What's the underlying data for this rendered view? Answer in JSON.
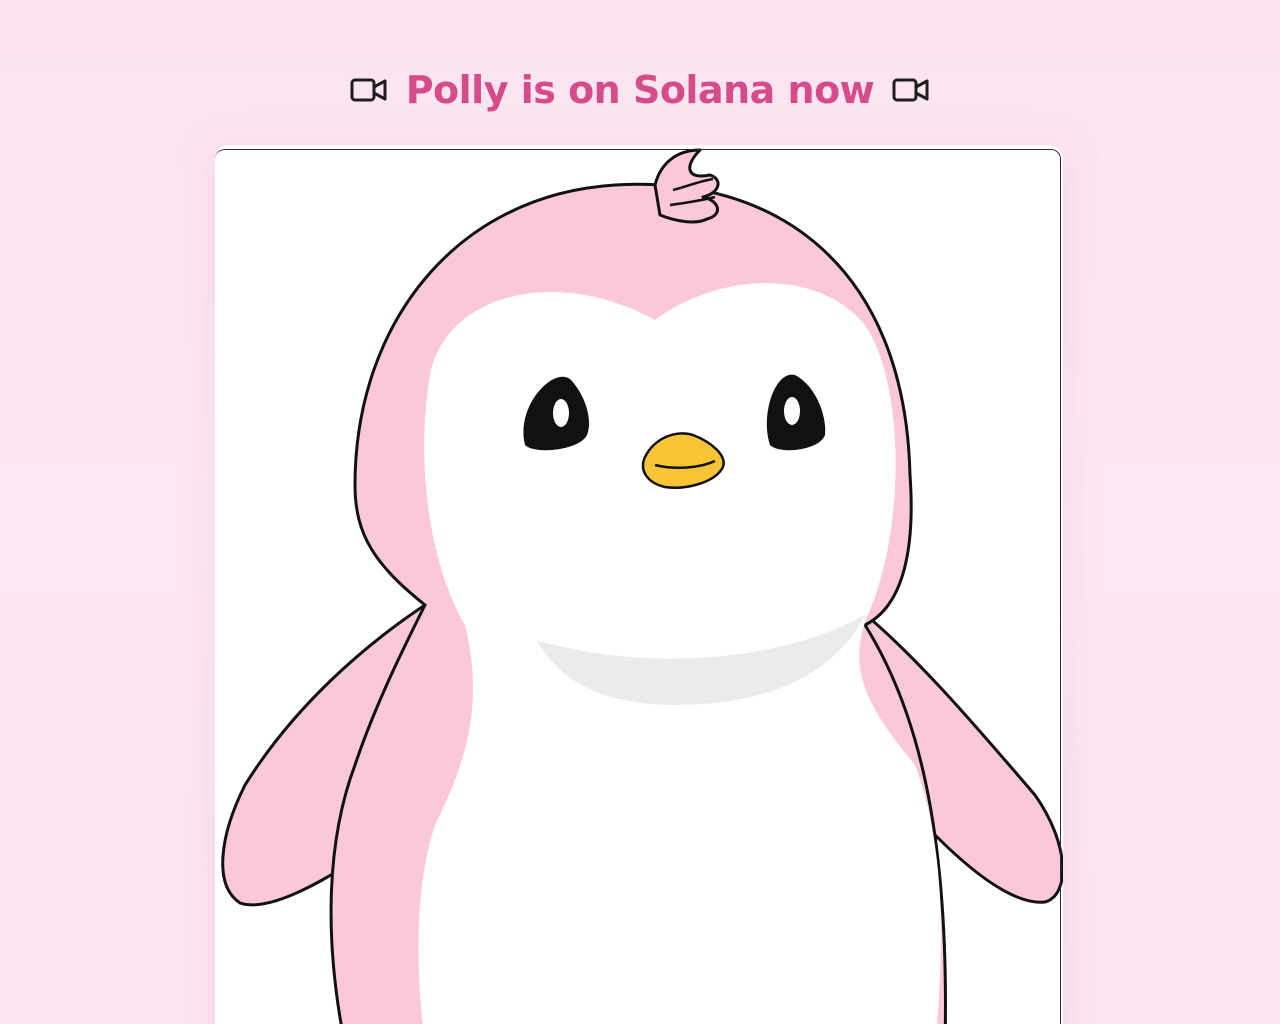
{
  "header": {
    "title": "Polly is on Solana now",
    "left_icon": "video-camera-icon",
    "right_icon": "video-camera-icon"
  },
  "media": {
    "kind": "penguin-illustration",
    "colors": {
      "accent": "#d64b8a",
      "penguin_body": "#fac8d8",
      "beak": "#f9c536",
      "background": "#fbe4f0"
    }
  }
}
